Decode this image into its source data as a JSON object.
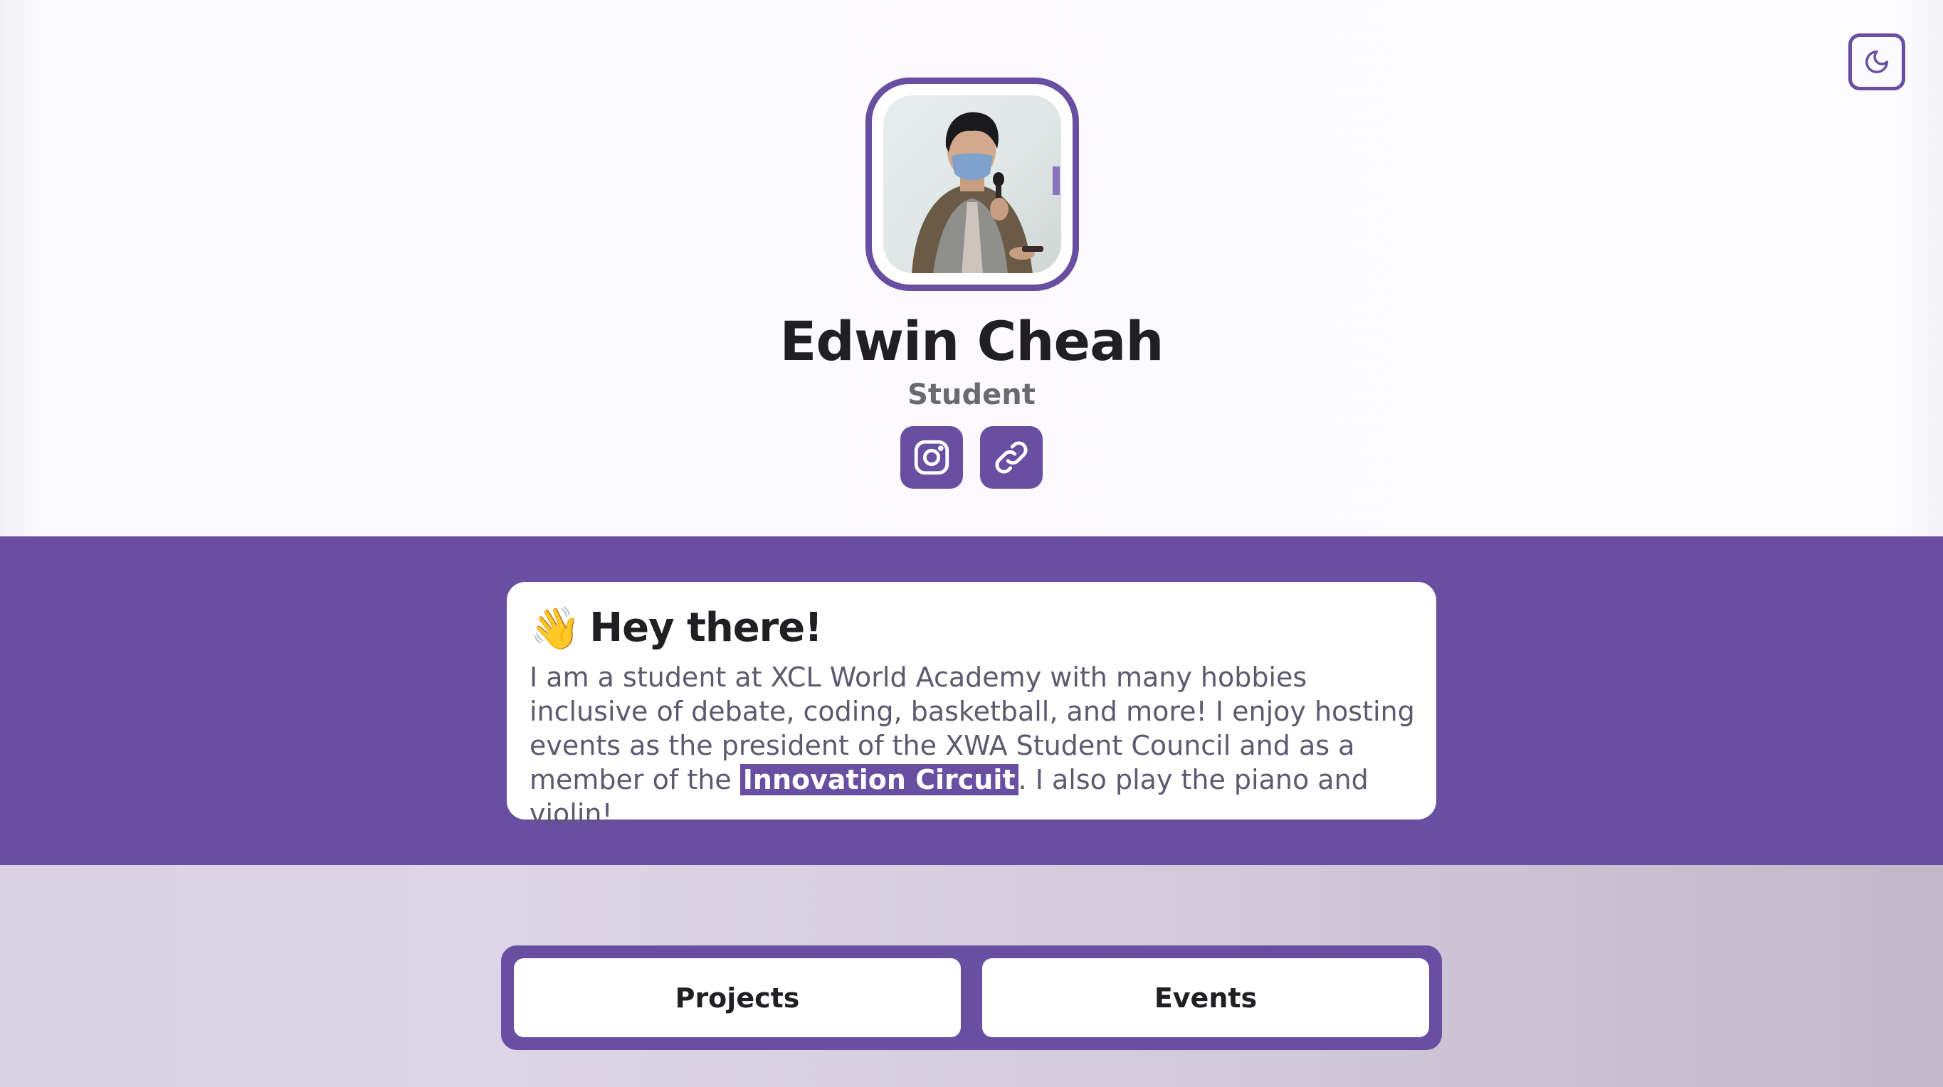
{
  "profile": {
    "name": "Edwin Cheah",
    "role": "Student",
    "avatar_icon": "student-portrait"
  },
  "header": {
    "theme_toggle_icon": "moon-icon"
  },
  "socials": [
    {
      "icon": "instagram-icon"
    },
    {
      "icon": "link-icon"
    }
  ],
  "about": {
    "emoji": "👋",
    "heading": "Hey there!",
    "bio_part1": "I am a student at XCL World Academy with many hobbies inclusive of debate, coding, basketball, and more! I enjoy hosting events as the president of the XWA Student Council and as a member of the ",
    "bio_highlight": "Innovation Circuit",
    "bio_part2": ". I also play the piano and violin!"
  },
  "tabs": {
    "projects_label": "Projects",
    "events_label": "Events"
  },
  "colors": {
    "accent": "#684fa1",
    "text": "#202024",
    "muted": "#6a6a72"
  }
}
